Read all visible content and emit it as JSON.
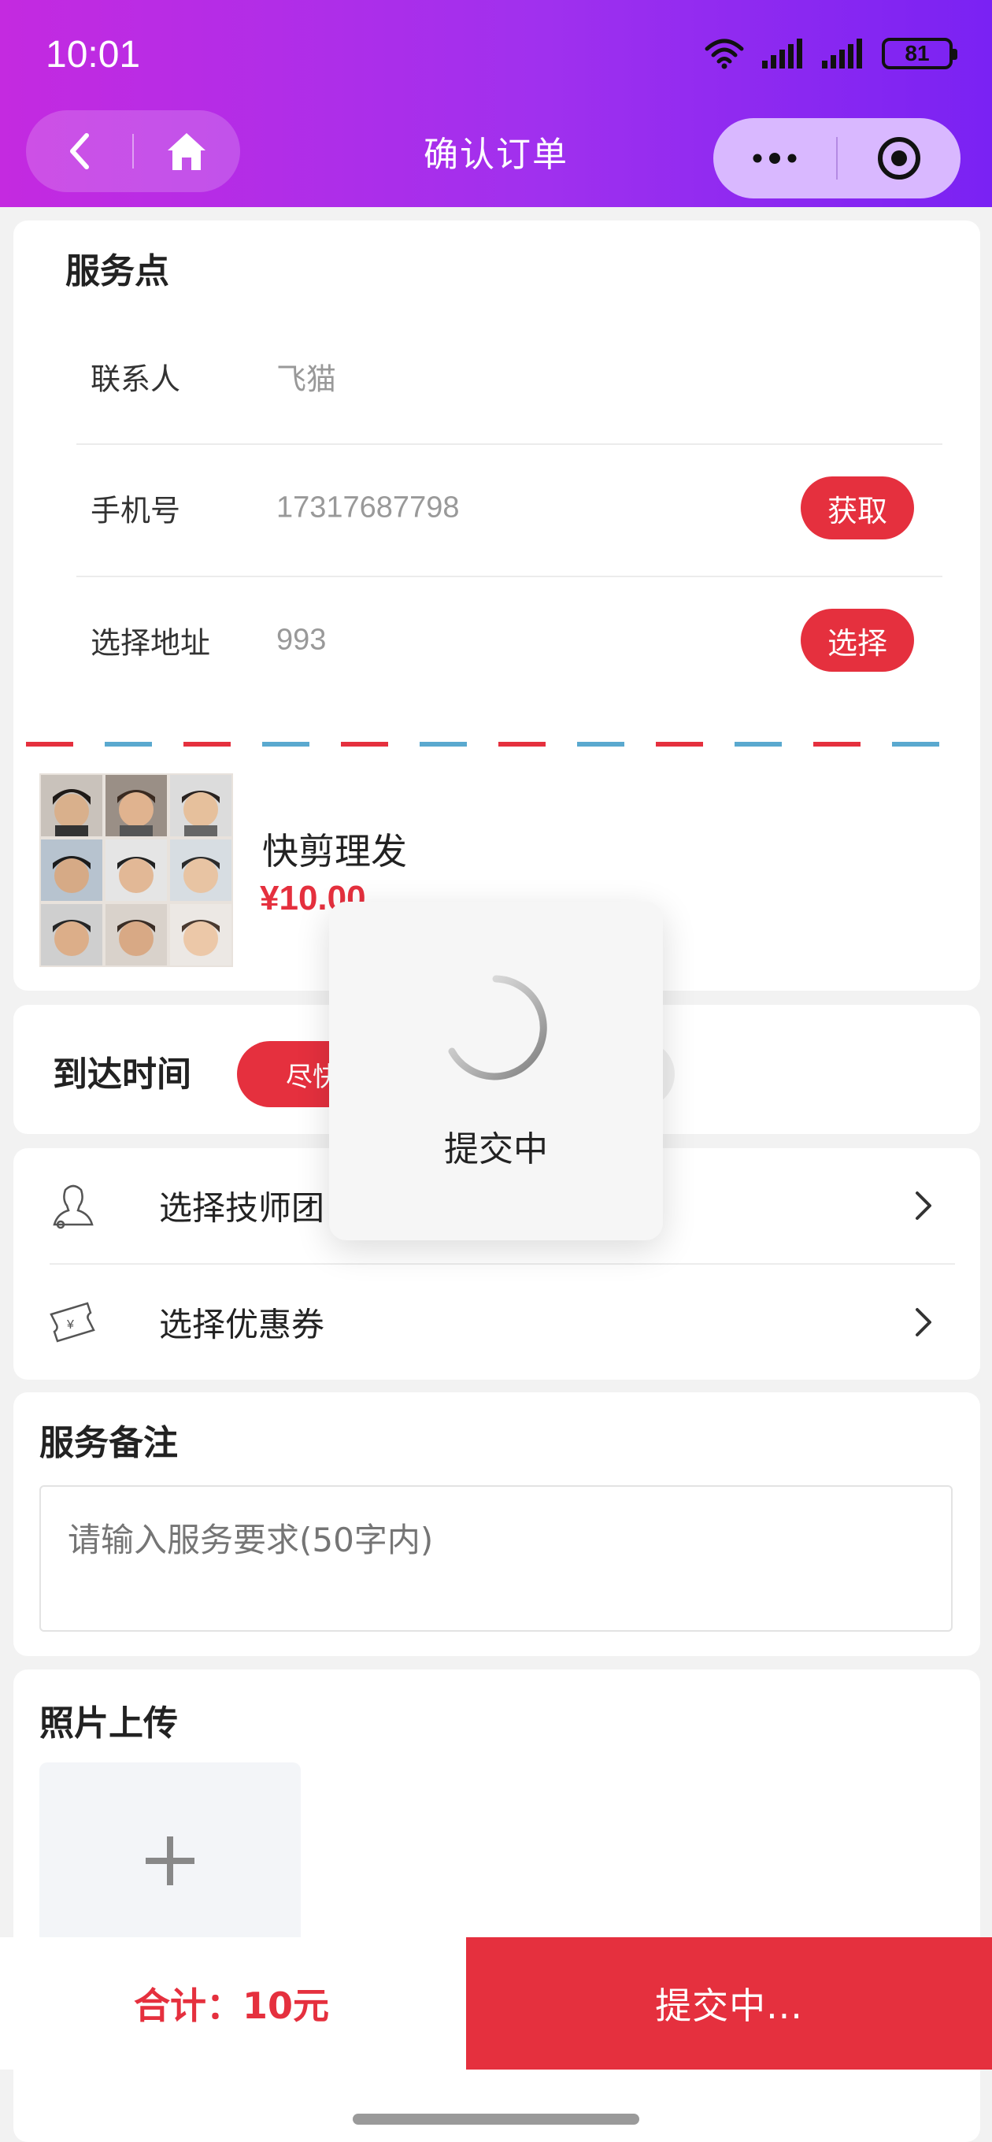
{
  "status_bar": {
    "time": "10:01",
    "battery": "81"
  },
  "header": {
    "title": "确认订单"
  },
  "service_point": {
    "title": "服务点",
    "contact": {
      "label": "联系人",
      "value": "飞猫"
    },
    "phone": {
      "label": "手机号",
      "value": "17317687798",
      "button": "获取"
    },
    "address": {
      "label": "选择地址",
      "value": "993",
      "button": "选择"
    }
  },
  "product": {
    "name": "快剪理发",
    "price": "¥10.00"
  },
  "arrival": {
    "label": "到达时间",
    "option": "尽快"
  },
  "options": [
    {
      "label": "选择技师团",
      "icon": "technician-icon"
    },
    {
      "label": "选择优惠券",
      "icon": "coupon-icon"
    }
  ],
  "remark": {
    "title": "服务备注",
    "placeholder": "请输入服务要求(50字内)"
  },
  "upload": {
    "title": "照片上传"
  },
  "footer": {
    "total": "合计：10元",
    "submit": "提交中..."
  },
  "toast": {
    "text": "提交中"
  },
  "colors": {
    "accent": "#e5303e",
    "header_start": "#c42ae0",
    "header_end": "#7a22f3",
    "capsule": "#d9b8ff"
  }
}
